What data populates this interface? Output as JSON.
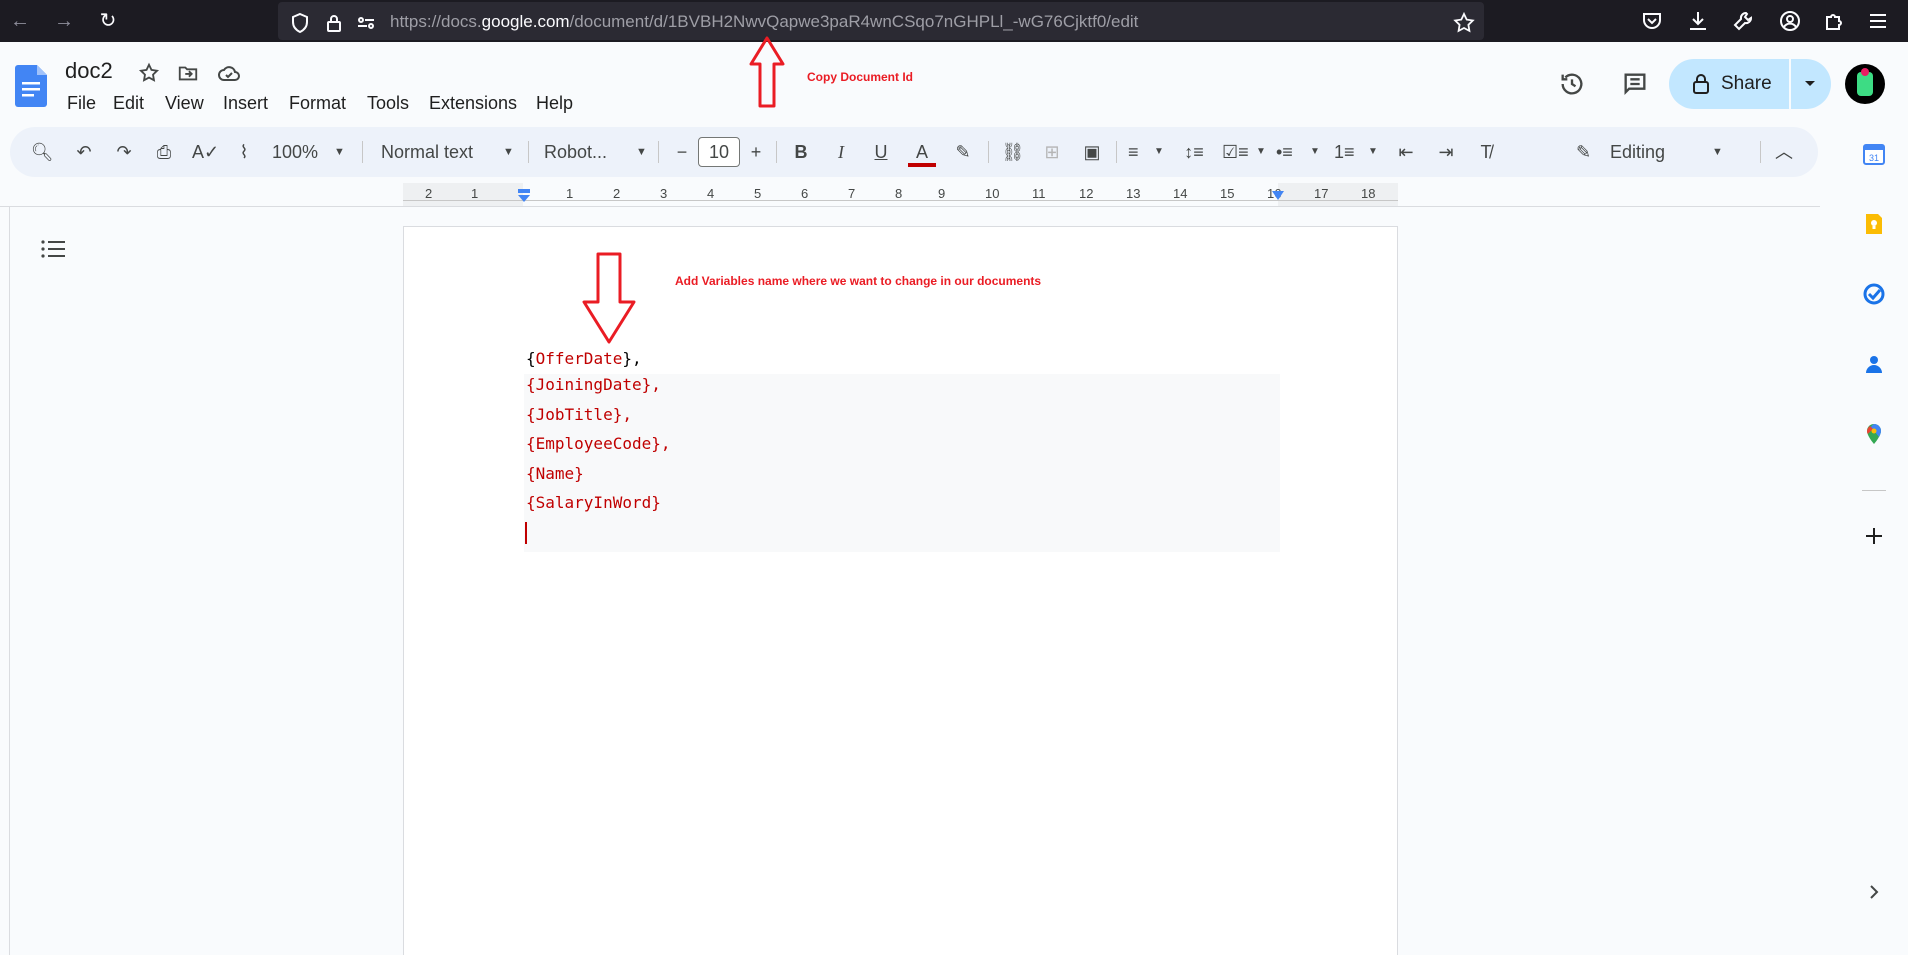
{
  "browser": {
    "url_prefix": "https://docs.",
    "url_domain": "google.com",
    "url_suffix": "/document/d/1BVBH2NwvQapwe3paR4wnCSqo7nGHPLl_-wG76Cjktf0/edit"
  },
  "docs": {
    "title": "doc2",
    "menus": [
      "File",
      "Edit",
      "View",
      "Insert",
      "Format",
      "Tools",
      "Extensions",
      "Help"
    ],
    "share_label": "Share"
  },
  "toolbar": {
    "zoom": "100%",
    "style": "Normal text",
    "font": "Robot...",
    "font_size": "10",
    "mode": "Editing"
  },
  "ruler": {
    "labels": [
      "2",
      "1",
      "1",
      "2",
      "3",
      "4",
      "5",
      "6",
      "7",
      "8",
      "9",
      "10",
      "11",
      "12",
      "13",
      "14",
      "15",
      "16",
      "17",
      "18"
    ]
  },
  "document": {
    "first_line_open": "{",
    "first_line_var": "OfferDate",
    "first_line_close": "},",
    "lines": [
      "{JoiningDate},",
      "{JobTitle},",
      "{EmployeeCode},",
      "{Name}",
      "{SalaryInWord}"
    ]
  },
  "annotations": {
    "copy_id": "Copy Document Id",
    "add_vars": "Add Variables name where we want to change in our documents",
    "color": "#ea1c24"
  }
}
